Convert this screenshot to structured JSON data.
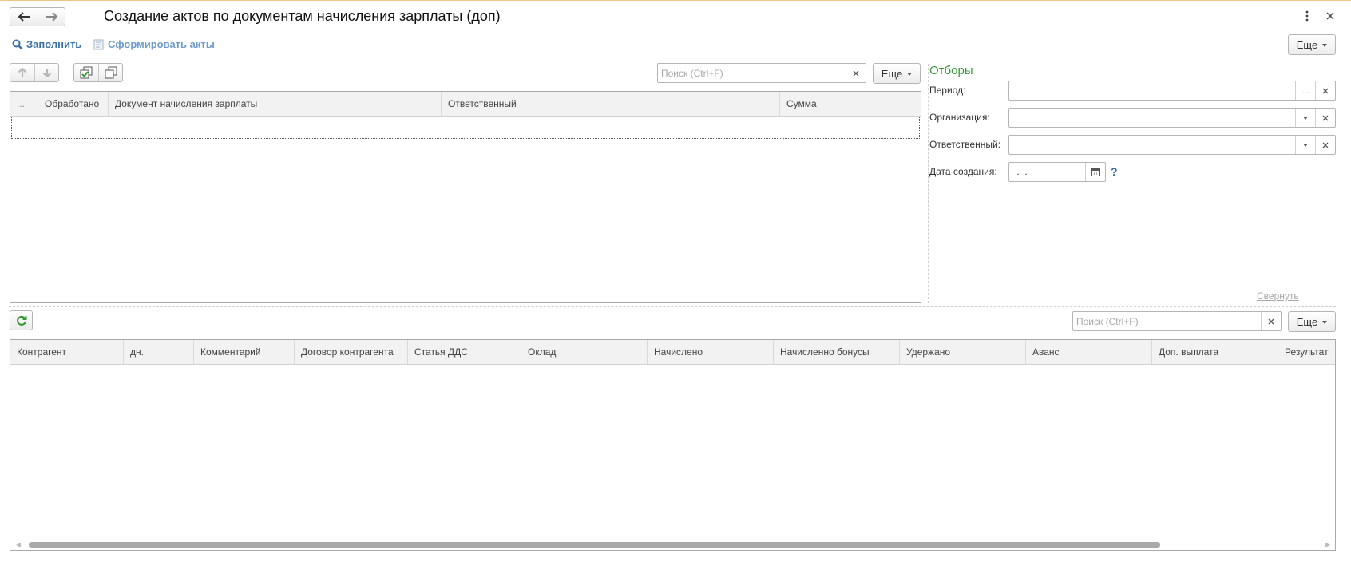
{
  "window": {
    "title": "Создание актов по документам начисления зарплаты (доп)",
    "more_icon": "vertical-dots-icon",
    "close_icon": "close-icon"
  },
  "nav": {
    "back_icon": "arrow-left-icon",
    "forward_icon": "arrow-right-icon"
  },
  "commands": {
    "fill_label": "Заполнить",
    "form_acts_label": "Сформировать акты",
    "more_label": "Еще"
  },
  "top_table": {
    "toolbar": {
      "up_icon": "arrow-up-icon",
      "down_icon": "arrow-down-icon",
      "check_all_icon": "check-all-icon",
      "uncheck_all_icon": "uncheck-all-icon"
    },
    "search_placeholder": "Поиск (Ctrl+F)",
    "more_label": "Еще",
    "columns": [
      "...",
      "Обработано",
      "Документ начисления зарплаты",
      "Ответственный",
      "Сумма"
    ]
  },
  "filters": {
    "title": "Отборы",
    "period_label": "Период:",
    "org_label": "Организация:",
    "responsible_label": "Ответственный:",
    "date_label": "Дата создания:",
    "date_value": " .  .",
    "help_label": "?",
    "collapse_label": "Свернуть",
    "select_btn": "...",
    "clear_btn": "×"
  },
  "bottom_table": {
    "refresh_icon": "refresh-icon",
    "search_placeholder": "Поиск (Ctrl+F)",
    "more_label": "Еще",
    "columns": [
      "Контрагент",
      "дн.",
      "Комментарий",
      "Договор контрагента",
      "Статья ДДС",
      "Оклад",
      "Начислено",
      "Начисленно бонусы",
      "Удержано",
      "Аванс",
      "Доп. выплата",
      "Результат"
    ]
  },
  "colors": {
    "accent_green": "#3a9a3a",
    "link_blue": "#4a7fb5"
  }
}
